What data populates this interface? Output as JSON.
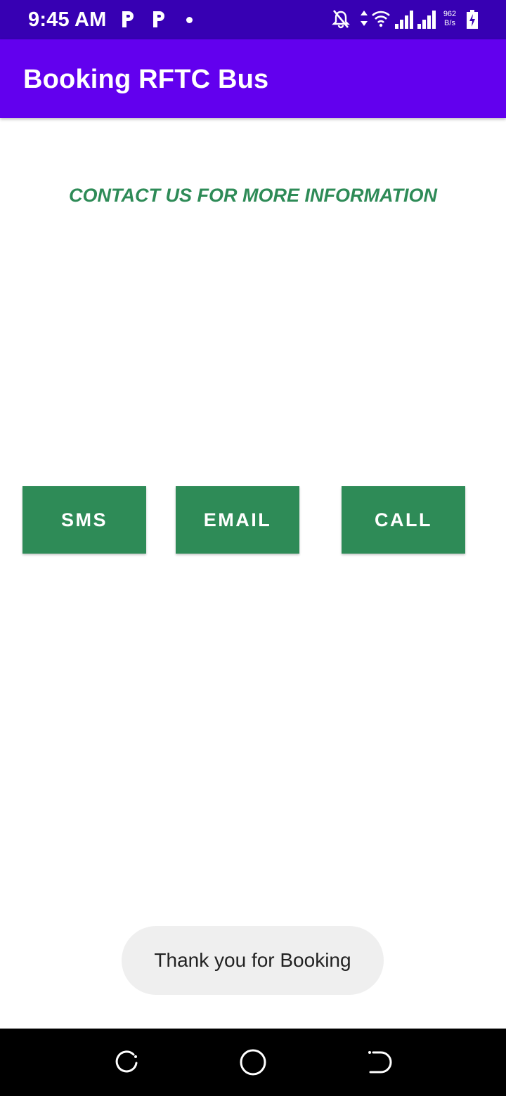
{
  "status_bar": {
    "time": "9:45 AM",
    "net_speed_value": "962",
    "net_speed_unit": "B/s",
    "icons": [
      "parking-icon",
      "parking-icon",
      "dot-icon",
      "bell-off-icon",
      "data-arrows-icon",
      "wifi-icon",
      "signal-icon",
      "signal-icon",
      "battery-charging-icon"
    ]
  },
  "app_bar": {
    "title": "Booking RFTC Bus"
  },
  "main": {
    "heading": "CONTACT US FOR MORE INFORMATION",
    "buttons": {
      "sms": "SMS",
      "email": "EMAIL",
      "call": "CALL"
    }
  },
  "toast": {
    "message": "Thank you for Booking"
  },
  "nav_bar": {
    "icons": [
      "recents-icon",
      "home-icon",
      "back-icon"
    ]
  },
  "colors": {
    "status_bar": "#3700b3",
    "app_bar": "#6200ee",
    "accent_green": "#2e8b57",
    "toast_bg": "#efefef",
    "nav_bar": "#000000"
  }
}
